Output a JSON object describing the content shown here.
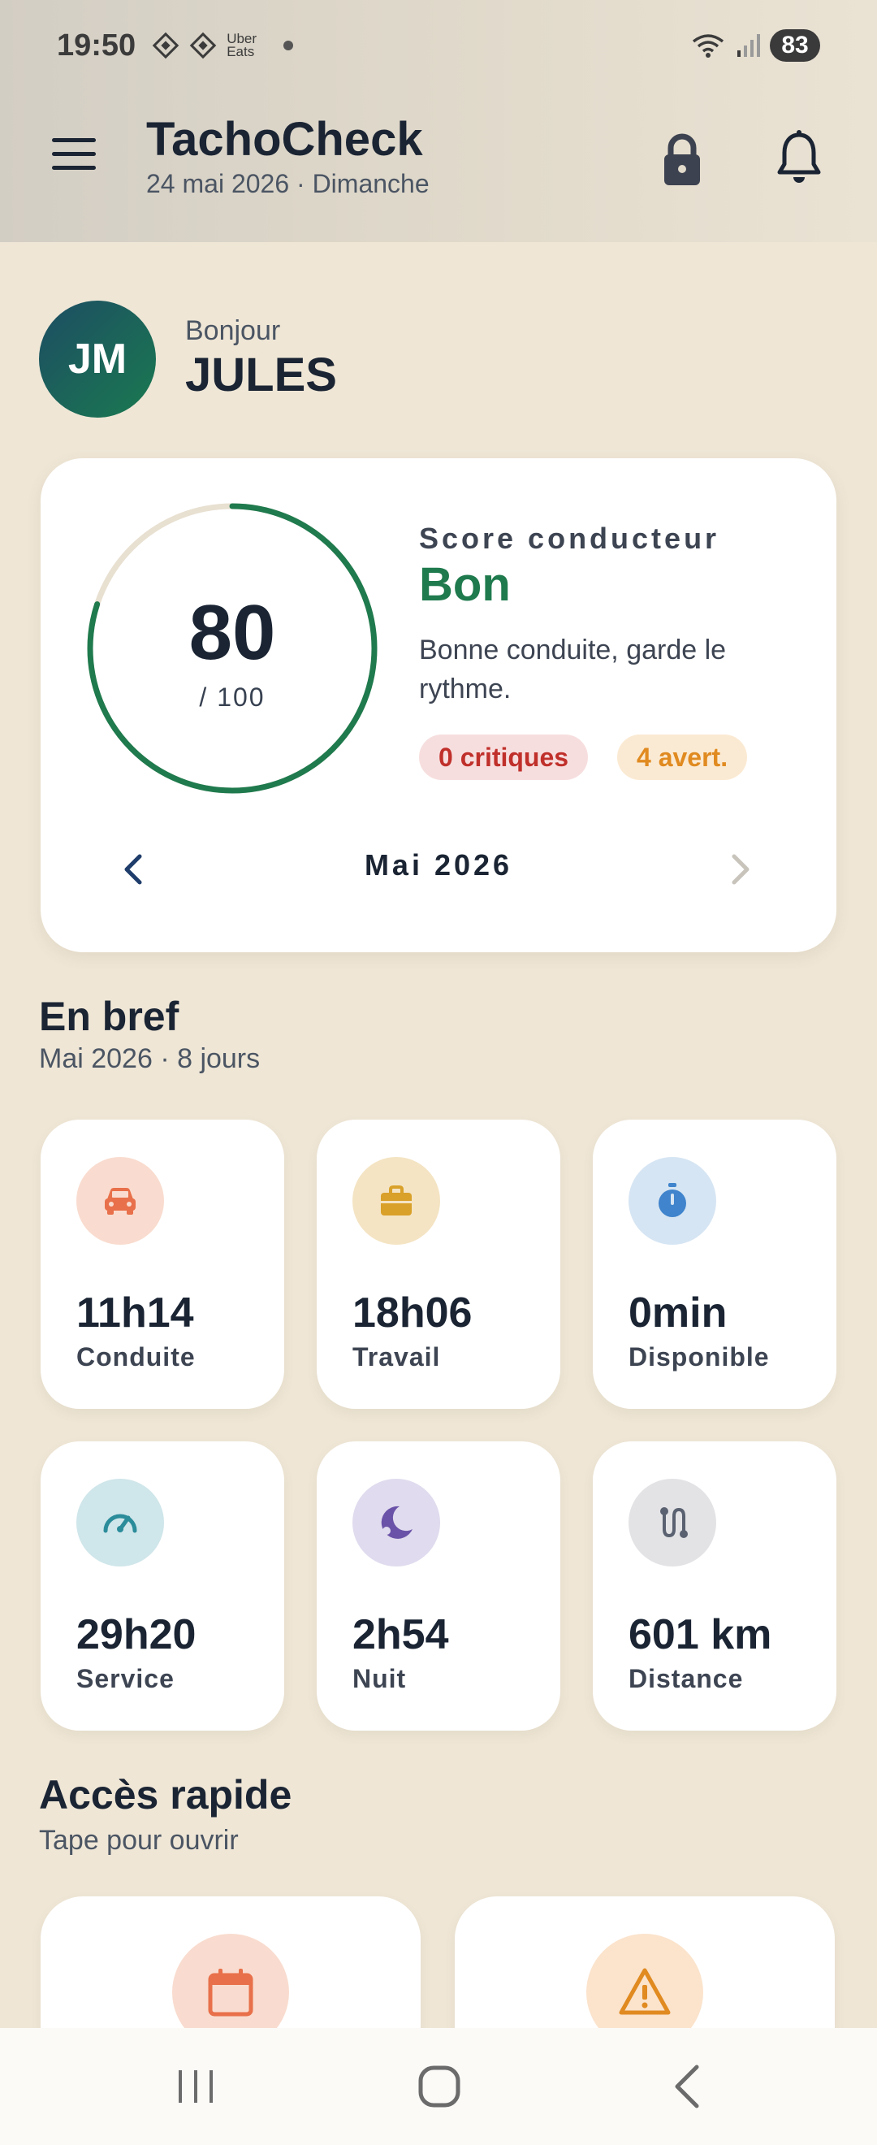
{
  "status_bar": {
    "time": "19:50",
    "notification_text": "Uber Eats",
    "battery": "83",
    "icons": [
      "diamond-icon",
      "diamond-icon",
      "wifi-icon",
      "signal-icon",
      "battery-icon"
    ]
  },
  "app_bar": {
    "title": "TachoCheck",
    "subtitle": "24 mai 2026 · Dimanche",
    "icons": [
      "menu-icon",
      "lock-icon",
      "bell-icon"
    ]
  },
  "greeting": {
    "initials": "JM",
    "hello": "Bonjour",
    "name": "JULES"
  },
  "score": {
    "value": "80",
    "max": "/ 100",
    "fraction": 0.8,
    "label": "Score conducteur",
    "rating": "Bon",
    "description": "Bonne conduite, garde le rythme.",
    "critical": "0 critiques",
    "warnings": "4 avert.",
    "month": "Mai 2026",
    "accent": "#1f7a4d"
  },
  "brief": {
    "title": "En bref",
    "subtitle": "Mai 2026 · 8 jours",
    "tiles": [
      {
        "value": "11h14",
        "label": "Conduite",
        "icon": "car-icon",
        "color": "#e8704a",
        "bg": "#f9dccf"
      },
      {
        "value": "18h06",
        "label": "Travail",
        "icon": "briefcase-icon",
        "color": "#d9a12a",
        "bg": "#f4e4c3"
      },
      {
        "value": "0min",
        "label": "Disponible",
        "icon": "stopwatch-icon",
        "color": "#3f84cc",
        "bg": "#d6e5f3"
      },
      {
        "value": "29h20",
        "label": "Service",
        "icon": "speedometer-icon",
        "color": "#2b8c9a",
        "bg": "#cfe6ea"
      },
      {
        "value": "2h54",
        "label": "Nuit",
        "icon": "moon-icon",
        "color": "#6a52a8",
        "bg": "#e0dbee"
      },
      {
        "value": "601 km",
        "label": "Distance",
        "icon": "route-icon",
        "color": "#5a6170",
        "bg": "#e3e3e6"
      }
    ]
  },
  "quick_access": {
    "title": "Accès rapide",
    "subtitle": "Tape pour ouvrir",
    "cards": [
      {
        "icon": "calendar-icon",
        "color": "#e8704a",
        "bg": "#f9dccf"
      },
      {
        "icon": "warning-icon",
        "color": "#e08a20",
        "bg": "#fbe3cc"
      }
    ]
  },
  "system_nav": [
    "recents-icon",
    "home-icon",
    "back-icon"
  ]
}
